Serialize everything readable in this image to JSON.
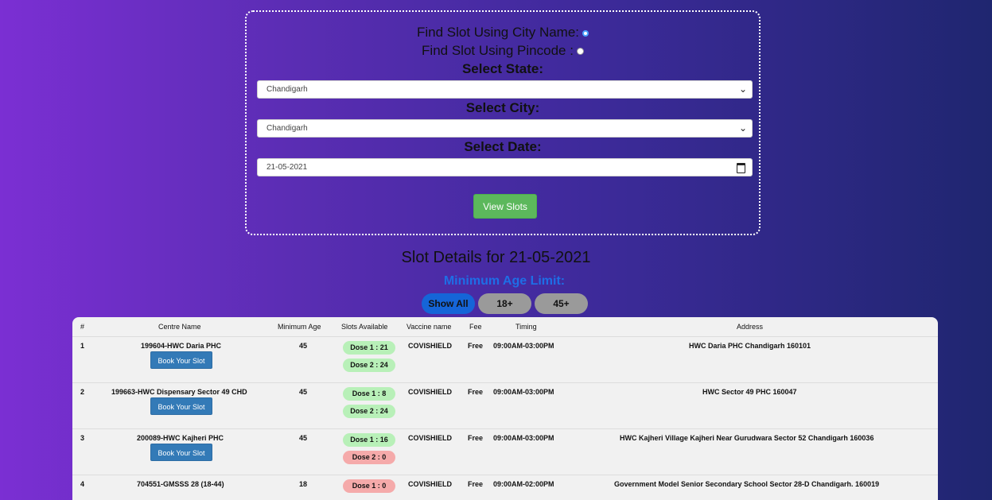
{
  "form": {
    "radio_city_label": "Find Slot Using City Name:",
    "radio_pincode_label": "Find Slot Using Pincode :",
    "state_label": "Select State:",
    "state_value": "Chandigarh",
    "city_label": "Select City:",
    "city_value": "Chandigarh",
    "date_label": "Select Date:",
    "date_value": "21-05-2021",
    "view_button": "View Slots"
  },
  "results": {
    "heading": "Slot Details for 21-05-2021",
    "age_filter_label": "Minimum Age Limit:",
    "filters": [
      "Show All",
      "18+",
      "45+"
    ]
  },
  "table": {
    "headers": [
      "#",
      "Centre Name",
      "Minimum Age",
      "Slots Available",
      "Vaccine name",
      "Fee",
      "Timing",
      "Address"
    ],
    "book_label": "Book Your Slot",
    "rows": [
      {
        "num": "1",
        "centre": "199604-HWC Daria PHC",
        "age": "45",
        "dose1": "Dose 1 : 21",
        "dose2": "Dose 2 : 24",
        "vaccine": "COVISHIELD",
        "fee": "Free",
        "timing": "09:00AM-03:00PM",
        "address": "HWC Daria PHC Chandigarh 160101"
      },
      {
        "num": "2",
        "centre": "199663-HWC Dispensary Sector 49 CHD",
        "age": "45",
        "dose1": "Dose 1 : 8",
        "dose2": "Dose 2 : 24",
        "vaccine": "COVISHIELD",
        "fee": "Free",
        "timing": "09:00AM-03:00PM",
        "address": "HWC Sector 49 PHC 160047"
      },
      {
        "num": "3",
        "centre": "200089-HWC Kajheri PHC",
        "age": "45",
        "dose1": "Dose 1 : 16",
        "dose2": "Dose 2 : 0",
        "vaccine": "COVISHIELD",
        "fee": "Free",
        "timing": "09:00AM-03:00PM",
        "address": "HWC Kajheri Village Kajheri Near Gurudwara Sector 52 Chandigarh 160036"
      },
      {
        "num": "4",
        "centre": "704551-GMSSS 28 (18-44)",
        "age": "18",
        "dose1": "Dose 1 : 0",
        "vaccine": "COVISHIELD",
        "fee": "Free",
        "timing": "09:00AM-02:00PM",
        "address": "Government Model Senior Secondary School Sector 28-D Chandigarh. 160019"
      }
    ]
  }
}
